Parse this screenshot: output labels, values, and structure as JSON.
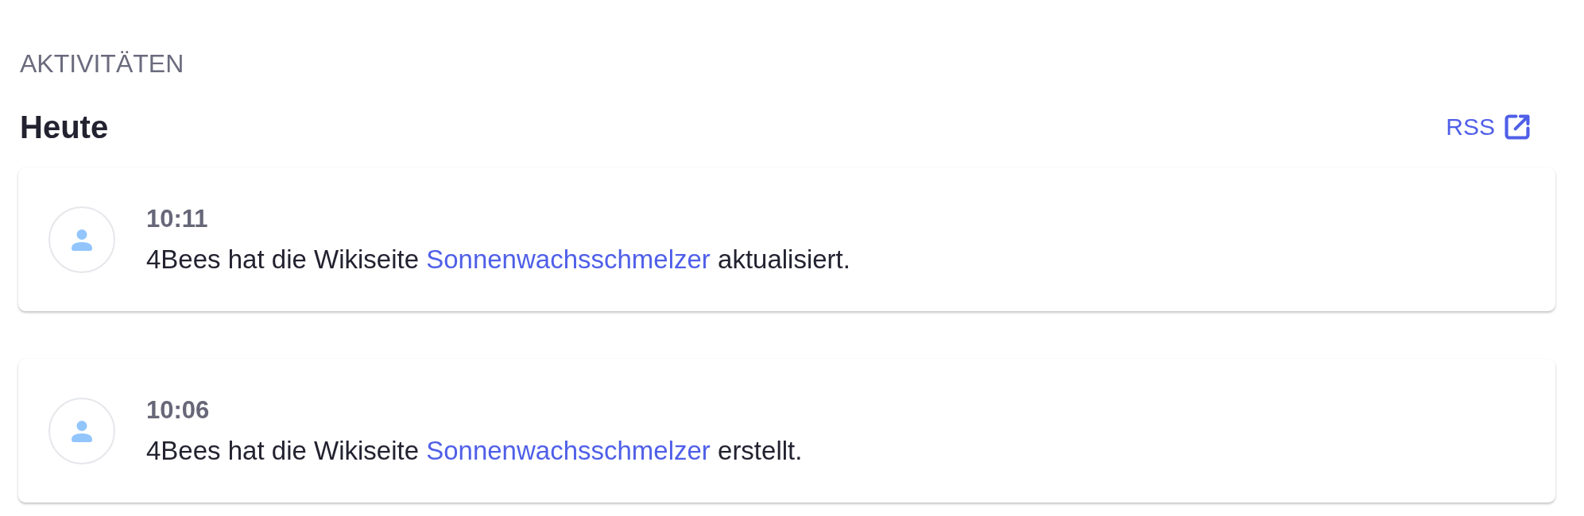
{
  "section_label": "AKTIVITÄTEN",
  "day": {
    "title": "Heute",
    "rss_link": {
      "label": "RSS"
    }
  },
  "activities": [
    {
      "time": "10:11",
      "before": "4Bees hat die Wikiseite",
      "link": "Sonnenwachsschmelzer",
      "after": "aktualisiert."
    },
    {
      "time": "10:06",
      "before": "4Bees hat die Wikiseite",
      "link": "Sonnenwachsschmelzer",
      "after": "erstellt."
    }
  ]
}
